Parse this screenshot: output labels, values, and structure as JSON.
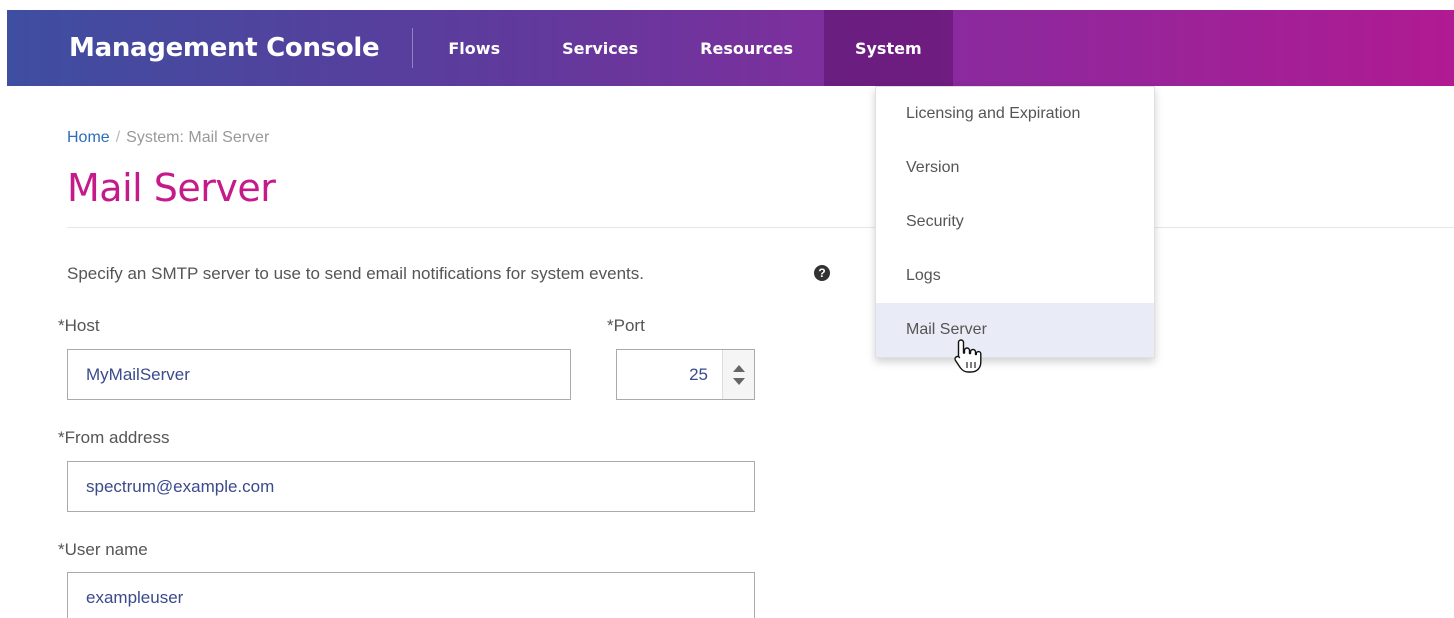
{
  "app": {
    "title": "Management Console"
  },
  "nav": {
    "items": [
      {
        "label": "Flows"
      },
      {
        "label": "Services"
      },
      {
        "label": "Resources"
      },
      {
        "label": "System",
        "active": true
      }
    ]
  },
  "system_menu": {
    "items": [
      {
        "label": "Licensing and Expiration"
      },
      {
        "label": "Version"
      },
      {
        "label": "Security"
      },
      {
        "label": "Logs"
      },
      {
        "label": "Mail Server",
        "selected": true
      }
    ]
  },
  "breadcrumb": {
    "home": "Home",
    "separator": "/",
    "current": "System: Mail Server"
  },
  "page": {
    "title": "Mail Server",
    "description": "Specify an SMTP server to use to send email notifications for system events."
  },
  "form": {
    "host": {
      "label": "*Host",
      "value": "MyMailServer"
    },
    "port": {
      "label": "*Port",
      "value": "25"
    },
    "from_address": {
      "label": "*From address",
      "value": "spectrum@example.com"
    },
    "user_name": {
      "label": "*User name",
      "value": "exampleuser"
    }
  },
  "icons": {
    "help": "question-circle-icon",
    "cursor": "hand-pointer-icon"
  },
  "colors": {
    "title_accent": "#c41a8a",
    "link": "#2a6ebb",
    "header_gradient_start": "#3e4ea0",
    "header_gradient_end": "#b01a92",
    "selected_menu_bg": "#e9ebf6"
  }
}
